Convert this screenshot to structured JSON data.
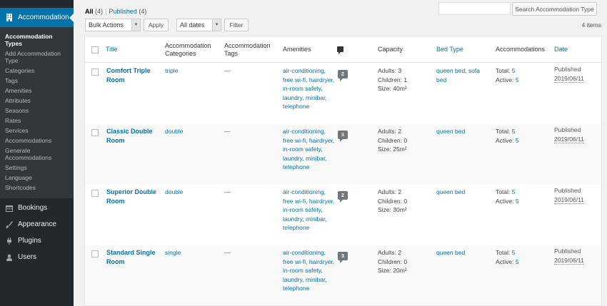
{
  "sidebar": {
    "active": "Accommodation",
    "submenu": [
      "Accommodation Types",
      "Add Accommodation Type",
      "Categories",
      "Tags",
      "Amenities",
      "Attributes",
      "Seasons",
      "Rates",
      "Services",
      "Accommodations",
      "Generate Accommodations",
      "Settings",
      "Language",
      "Shortcodes"
    ],
    "menu": [
      {
        "label": "Bookings",
        "icon": "calendar-icon"
      },
      {
        "label": "Appearance",
        "icon": "paintbrush-icon"
      },
      {
        "label": "Plugins",
        "icon": "plugin-icon"
      },
      {
        "label": "Users",
        "icon": "users-icon"
      }
    ]
  },
  "views": {
    "all": "All",
    "all_count": "(4)",
    "sep": "|",
    "published": "Published",
    "published_count": "(4)"
  },
  "search": {
    "button": "Search Accommodation Type",
    "value": ""
  },
  "tablenav": {
    "bulk": "Bulk Actions",
    "apply": "Apply",
    "dates": "All dates",
    "filter": "Filter",
    "items": "4 items"
  },
  "columns": {
    "title": "Title",
    "categories": "Accommodation Categories",
    "tags": "Accommodation Tags",
    "amenities": "Amenities",
    "capacity": "Capacity",
    "bed": "Bed Type",
    "accommodations": "Accommodations",
    "date": "Date"
  },
  "rows": [
    {
      "title": "Comfort Triple Room",
      "category": "triple",
      "tags": "—",
      "amenities": "air-conditioning, free wi-fi, hairdryer, in-room safety, laundry, minibar, telephone",
      "comments": "2",
      "adults": "Adults: 3",
      "children": "Children: 1",
      "size": "Size: 40m²",
      "bed": "queen bed, sofa bed",
      "total_label": "Total:",
      "total": "5",
      "active_label": "Active:",
      "active": "5",
      "status": "Published",
      "date": "2019/06/11"
    },
    {
      "title": "Classic Double Room",
      "category": "double",
      "tags": "—",
      "amenities": "air-conditioning, free wi-fi, hairdryer, in-room safety, laundry, minibar, telephone",
      "comments": "3",
      "adults": "Adults: 2",
      "children": "Children: 0",
      "size": "Size: 25m²",
      "bed": "queen bed",
      "total_label": "Total:",
      "total": "5",
      "active_label": "Active:",
      "active": "5",
      "status": "Published",
      "date": "2019/06/11"
    },
    {
      "title": "Superior Double Room",
      "category": "double",
      "tags": "—",
      "amenities": "air-conditioning, free wi-fi, hairdryer, in-room safety, laundry, minibar, telephone",
      "comments": "2",
      "adults": "Adults: 2",
      "children": "Children: 0",
      "size": "Size: 30m²",
      "bed": "queen bed",
      "total_label": "Total:",
      "total": "5",
      "active_label": "Active:",
      "active": "5",
      "status": "Published",
      "date": "2019/06/11"
    },
    {
      "title": "Standard Single Room",
      "category": "single",
      "tags": "—",
      "amenities": "air-conditioning, free wi-fi, hairdryer, in-room safety, laundry, minibar, telephone",
      "comments": "3",
      "adults": "Adults: 2",
      "children": "Children: 0",
      "size": "Size: 20m²",
      "bed": "queen bed",
      "total_label": "Total:",
      "total": "5",
      "active_label": "Active:",
      "active": "5",
      "status": "Published",
      "date": "2019/06/11"
    }
  ]
}
